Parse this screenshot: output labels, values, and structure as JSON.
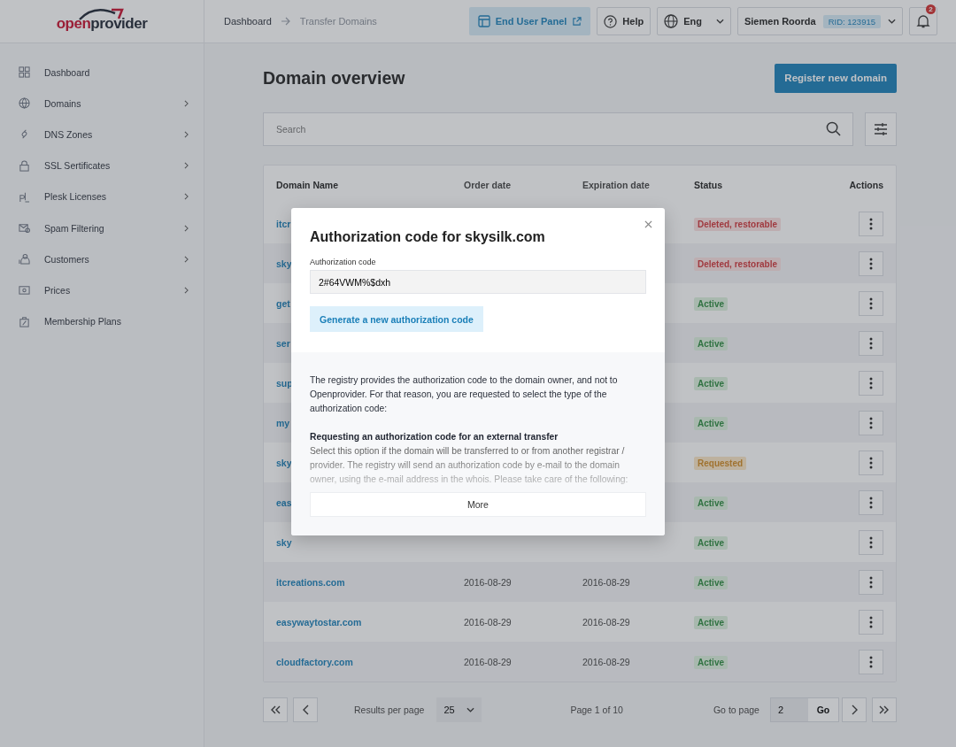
{
  "logo": {
    "part1": "open",
    "part2": "provider"
  },
  "breadcrumb": [
    {
      "label": "Dashboard",
      "current": false
    },
    {
      "label": "Transfer Domains",
      "current": true
    }
  ],
  "header": {
    "end_user_panel": "End User Panel",
    "help": "Help",
    "language": "Eng",
    "user": "Siemen Roorda",
    "rid": "RID: 123915",
    "notifications": "2"
  },
  "sidebar": {
    "items": [
      {
        "label": "Dashboard",
        "expandable": false
      },
      {
        "label": "Domains",
        "expandable": true
      },
      {
        "label": "DNS Zones",
        "expandable": true
      },
      {
        "label": "SSL Sertificates",
        "expandable": true
      },
      {
        "label": "Plesk Licenses",
        "expandable": true
      },
      {
        "label": "Spam Filtering",
        "expandable": true
      },
      {
        "label": "Customers",
        "expandable": true
      },
      {
        "label": "Prices",
        "expandable": true
      },
      {
        "label": "Membership Plans",
        "expandable": false
      }
    ]
  },
  "page": {
    "title": "Domain overview",
    "register_button": "Register new domain",
    "search": {
      "placeholder": "Search"
    }
  },
  "table": {
    "columns": [
      "Domain Name",
      "Order date",
      "Expiration date",
      "Status",
      "Actions"
    ],
    "rows": [
      {
        "domain": "itcr",
        "status": {
          "text": "Deleted, restorable",
          "kind": "deleted"
        }
      },
      {
        "domain": "sky",
        "status": {
          "text": "Deleted, restorable",
          "kind": "deleted"
        }
      },
      {
        "domain": "get",
        "status": {
          "text": "Active",
          "kind": "active"
        }
      },
      {
        "domain": "ser",
        "status": {
          "text": "Active",
          "kind": "active"
        }
      },
      {
        "domain": "sup",
        "status": {
          "text": "Active",
          "kind": "active"
        }
      },
      {
        "domain": "my",
        "status": {
          "text": "Active",
          "kind": "active"
        }
      },
      {
        "domain": "sky",
        "status": {
          "text": "Requested",
          "kind": "requested"
        }
      },
      {
        "domain": "eas",
        "status": {
          "text": "Active",
          "kind": "active"
        }
      },
      {
        "domain": "sky",
        "status": {
          "text": "Active",
          "kind": "active"
        }
      },
      {
        "domain": "itcreations.com",
        "order_date": "2016-08-29",
        "expiration_date": "2016-08-29",
        "status": {
          "text": "Active",
          "kind": "active"
        }
      },
      {
        "domain": "easywaytostar.com",
        "order_date": "2016-08-29",
        "expiration_date": "2016-08-29",
        "status": {
          "text": "Active",
          "kind": "active"
        }
      },
      {
        "domain": "cloudfactory.com",
        "order_date": "2016-08-29",
        "expiration_date": "2016-08-29",
        "status": {
          "text": "Active",
          "kind": "active"
        }
      }
    ]
  },
  "pagination": {
    "results_label": "Results per page",
    "per_page": "25",
    "page_info": "Page 1 of 10",
    "goto_label": "Go to page",
    "goto_value": "2",
    "go_button": "Go"
  },
  "modal": {
    "title": "Authorization code for skysilk.com",
    "field_label": "Authorization code",
    "field_value": "2#64VWM%$dxh",
    "generate_button": "Generate a new authorization code",
    "intro": "The registry provides the authorization code to the domain owner, and not to Openprovider. For that reason, you are requested to select the type of the authorization code:",
    "section_title": "Requesting an authorization code for an external transfer",
    "section_text": "Select this option if the domain will be transferred to or from another registrar / provider. The registry will send an authorization code by e-mail to the domain owner, using the e-mail address in the whois. Please take care of the following:",
    "more_button": "More"
  }
}
